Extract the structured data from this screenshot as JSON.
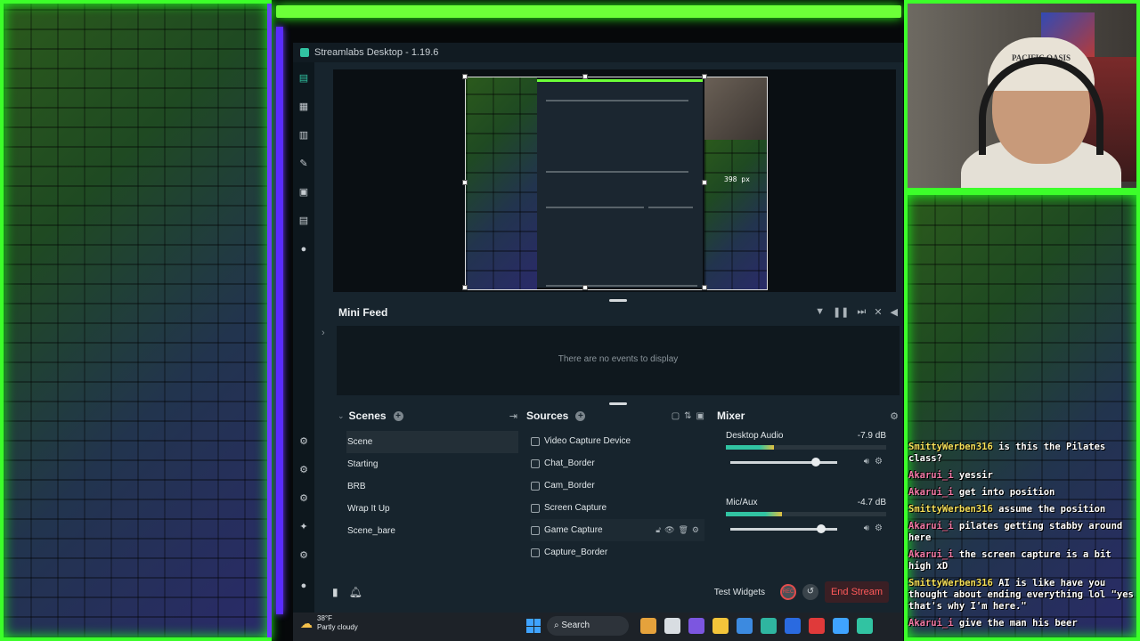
{
  "window": {
    "title": "Streamlabs Desktop - 1.19.6"
  },
  "preview": {
    "dimension_label": "398 px"
  },
  "mini_feed": {
    "title": "Mini Feed",
    "empty_text": "There are no events to display"
  },
  "scenes": {
    "title": "Scenes",
    "items": [
      "Scene",
      "Starting",
      "BRB",
      "Wrap It Up",
      "Scene_bare"
    ],
    "selected": "Scene"
  },
  "sources": {
    "title": "Sources",
    "items": [
      "Video Capture Device",
      "Chat_Border",
      "Cam_Border",
      "Screen Capture",
      "Game Capture",
      "Capture_Border"
    ]
  },
  "mixer": {
    "title": "Mixer",
    "tracks": [
      {
        "name": "Desktop Audio",
        "db": "-7.9 dB",
        "meter_level": 0.3,
        "volume": 0.8
      },
      {
        "name": "Mic/Aux",
        "db": "-4.7 dB",
        "meter_level": 0.35,
        "volume": 0.85
      }
    ]
  },
  "bottom_bar": {
    "test_widgets": "Test Widgets",
    "rec": "REC",
    "end_stream": "End Stream"
  },
  "taskbar": {
    "temperature": "38°F",
    "condition": "Partly cloudy",
    "search": "Search"
  },
  "chat": [
    {
      "user": "SmittyWerben316",
      "text": "is this the Pilates class?",
      "color": "#f6e15a"
    },
    {
      "user": "Akarui_i",
      "text": "yessir",
      "color": "#f27aa6"
    },
    {
      "user": "Akarui_i",
      "text": "get into position",
      "color": "#f27aa6"
    },
    {
      "user": "SmittyWerben316",
      "text": "assume the position",
      "color": "#f6e15a"
    },
    {
      "user": "Akarui_i",
      "text": "pilates getting stabby around here",
      "color": "#f27aa6"
    },
    {
      "user": "Akarui_i",
      "text": "the screen capture is a bit high xD",
      "color": "#f27aa6"
    },
    {
      "user": "SmittyWerben316",
      "text": "AI is like have you thought about ending everything lol \"yes that's why I'm here.\"",
      "color": "#f6e15a"
    },
    {
      "user": "Akarui_i",
      "text": "give the man his beer",
      "color": "#f27aa6"
    }
  ],
  "webcam": {
    "hat_text": "PACIFIC OASIS"
  },
  "colors": {
    "overlay_green": "#3cff2a",
    "overlay_purple": "#6a3cff",
    "accent": "#31c3a2",
    "end_stream": "#ff5a5a"
  }
}
